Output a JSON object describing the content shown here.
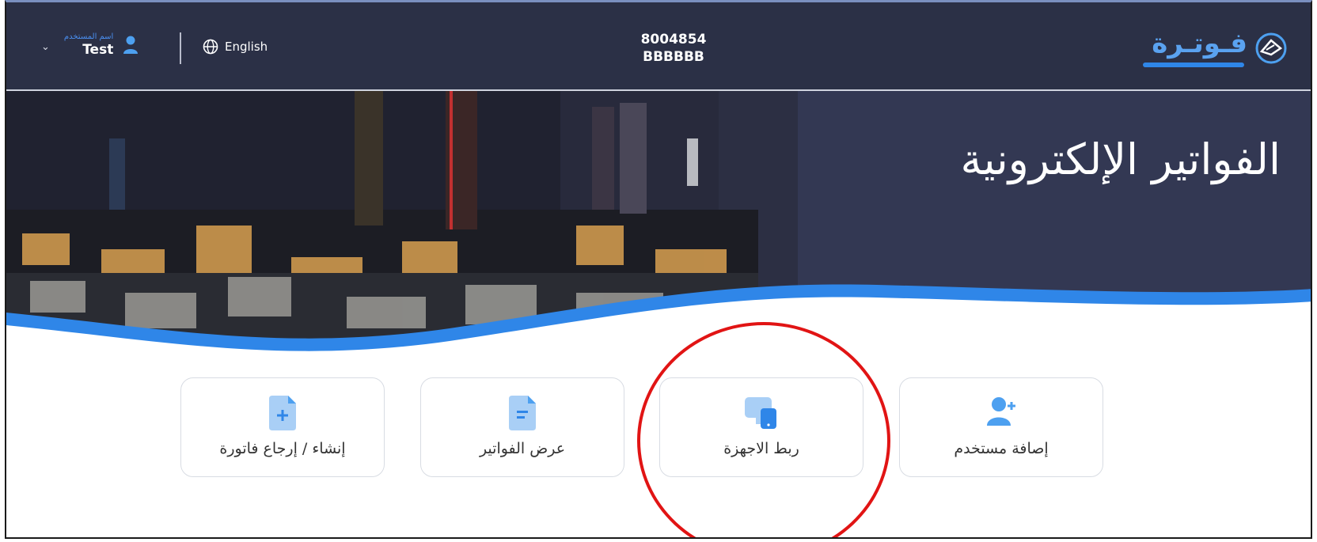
{
  "header": {
    "user_caption": "اسم المستخدم",
    "user_name": "Test",
    "language_label": "English",
    "account_number": "8004854",
    "account_code": "BBBBBB",
    "logo_text": "فـوتـرة"
  },
  "hero": {
    "title": "الفواتير الإلكترونية"
  },
  "cards": [
    {
      "label": "إصافة مستخدم",
      "icon": "add-user-icon"
    },
    {
      "label": "ربط الاجهزة",
      "icon": "devices-icon"
    },
    {
      "label": "عرض الفواتير",
      "icon": "document-view-icon"
    },
    {
      "label": "إنشاء / إرجاع فاتورة",
      "icon": "document-add-icon"
    }
  ],
  "colors": {
    "header_bg": "#2b3046",
    "accent_blue": "#2f86e8",
    "icon_blue": "#4da0f0",
    "annotation_red": "#e11414"
  }
}
